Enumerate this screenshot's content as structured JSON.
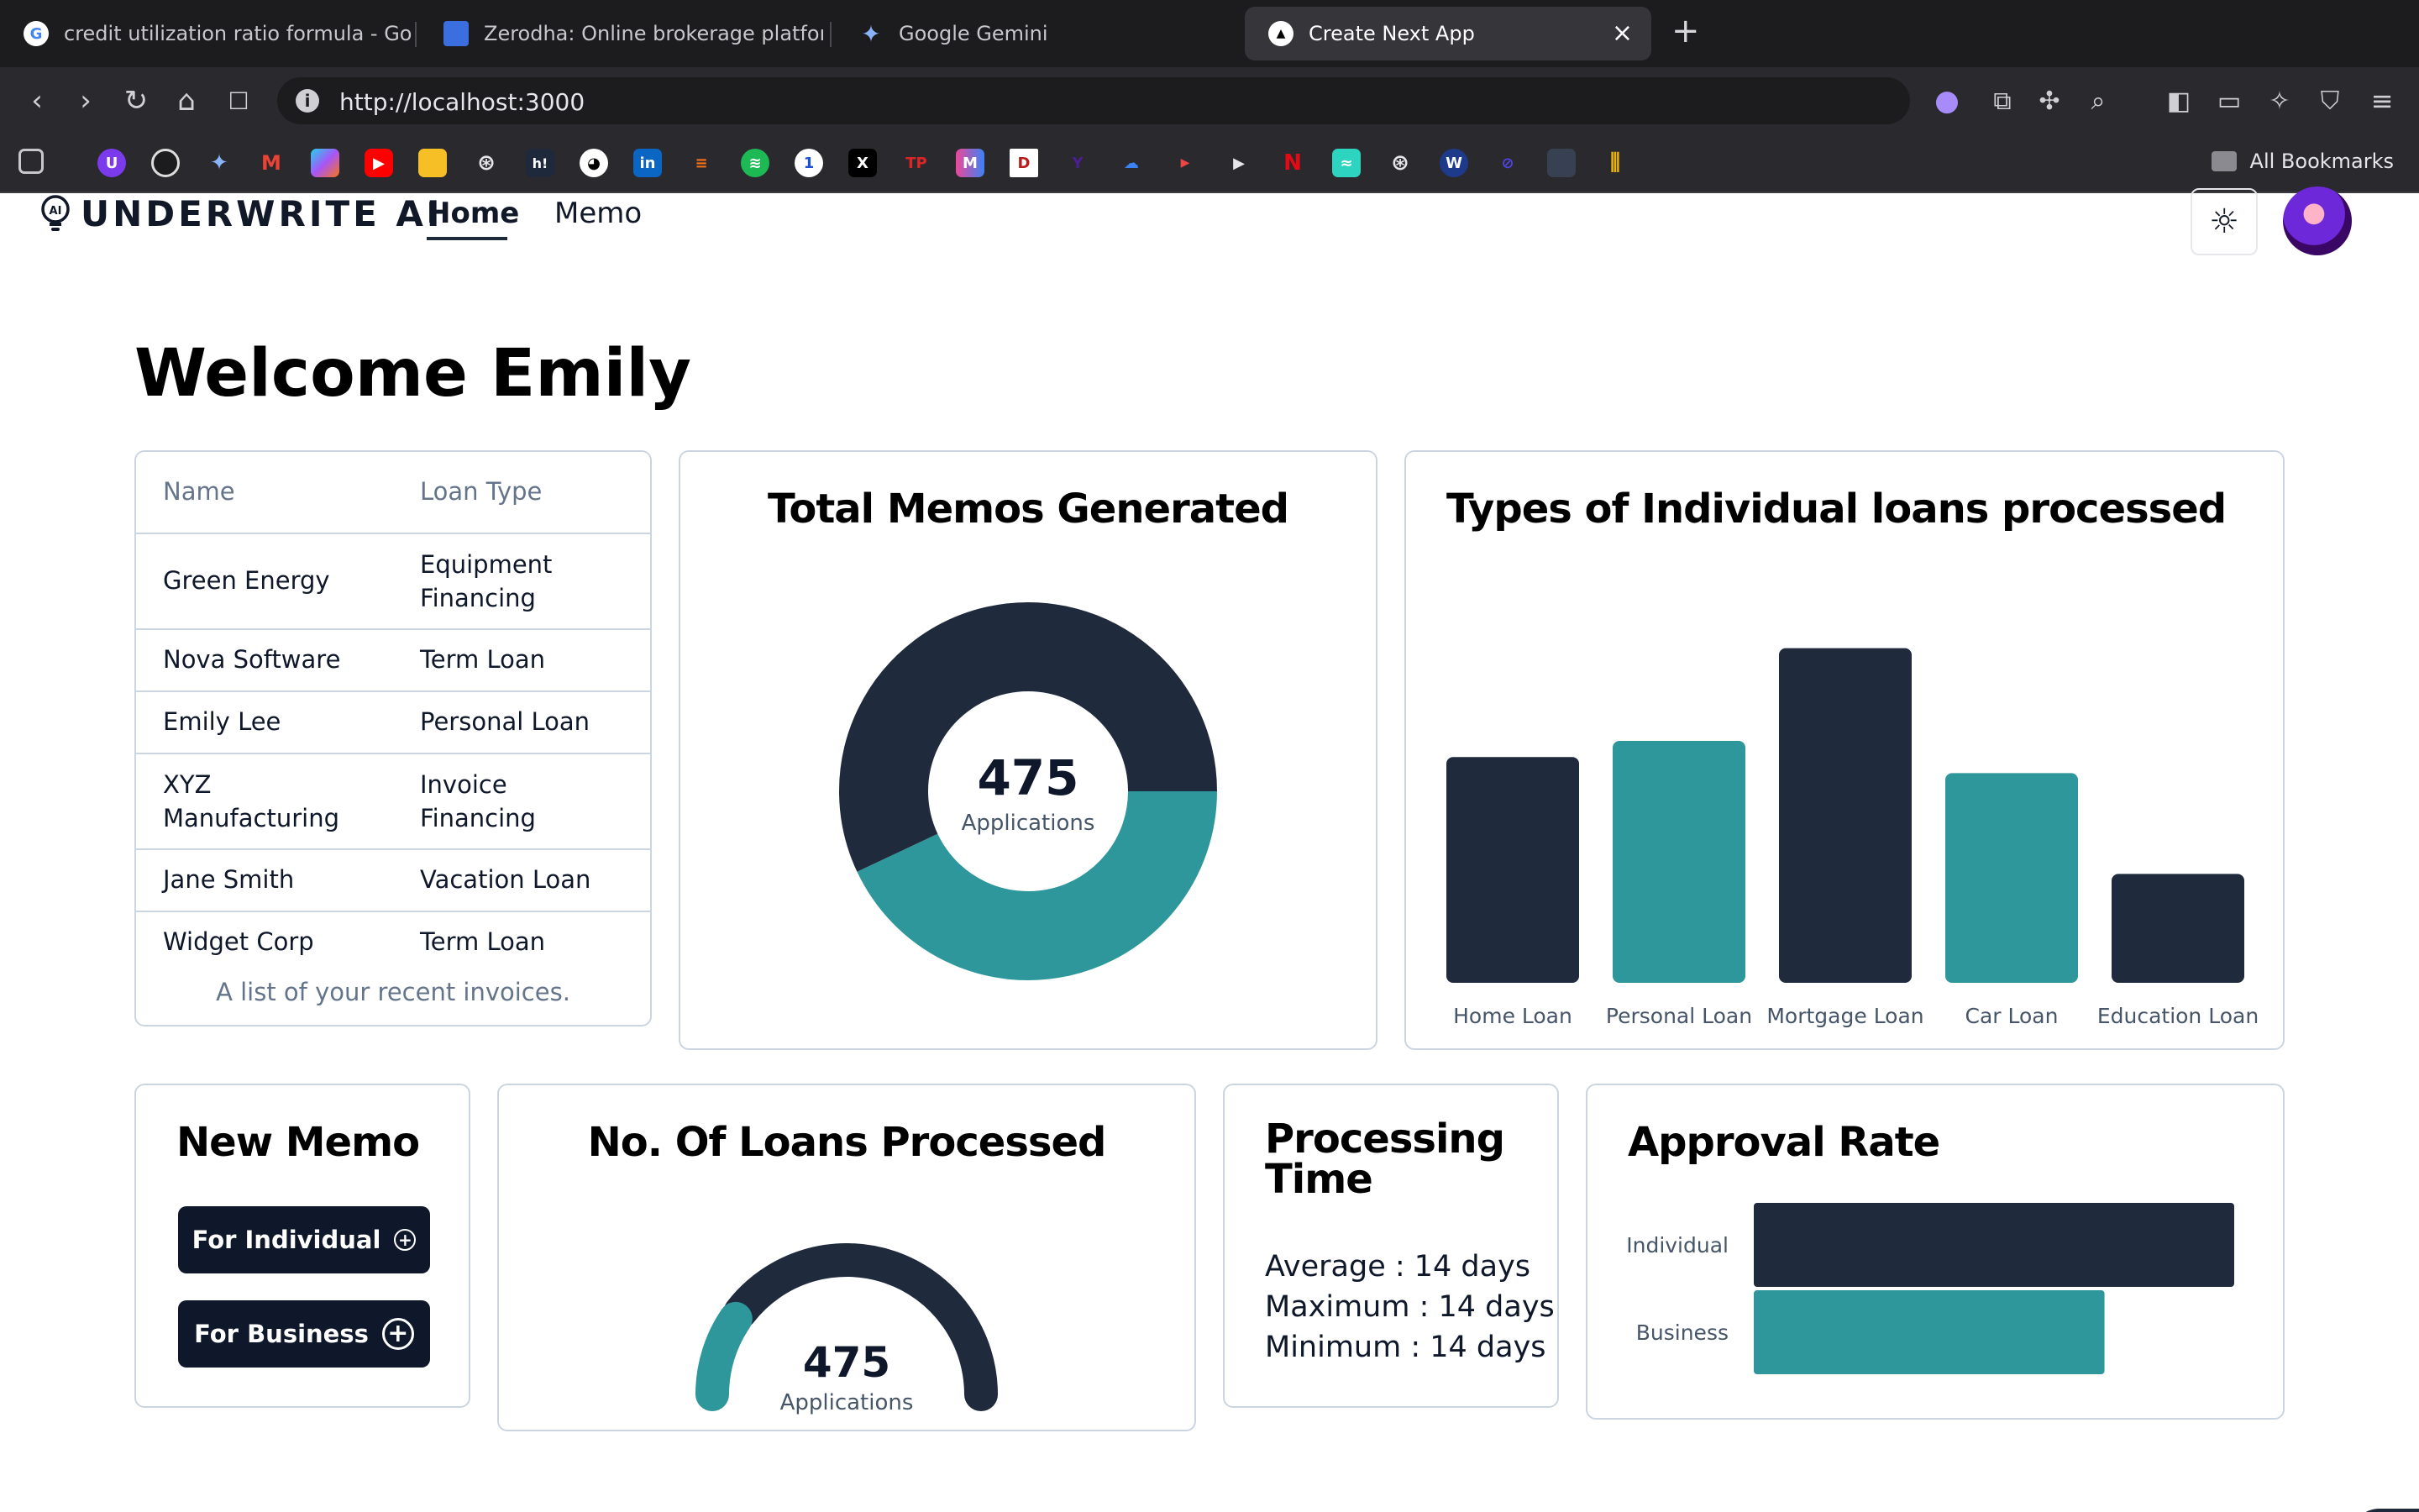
{
  "browser": {
    "tabs": [
      {
        "title": "credit utilization ratio formula - Go",
        "icon": "google-icon"
      },
      {
        "title": "Zerodha: Online brokerage platform",
        "icon": "zerodha-icon"
      },
      {
        "title": "Google Gemini",
        "icon": "gemini-icon"
      },
      {
        "title": "Create Next App",
        "icon": "nextjs-icon"
      }
    ],
    "url": "http://localhost:3000",
    "all_bookmarks": "All Bookmarks"
  },
  "app": {
    "logo_text": "UNDERWRITE AI",
    "nav": {
      "home": "Home",
      "memo": "Memo"
    },
    "welcome": "Welcome Emily"
  },
  "recent_table": {
    "headers": [
      "Name",
      "Loan Type"
    ],
    "rows": [
      {
        "name": "Green Energy",
        "type": "Equipment Financing"
      },
      {
        "name": "Nova Software",
        "type": "Term Loan"
      },
      {
        "name": "Emily Lee",
        "type": "Personal Loan"
      },
      {
        "name": "XYZ Manufacturing",
        "type": "Invoice Financing"
      },
      {
        "name": "Jane Smith",
        "type": "Vacation Loan"
      },
      {
        "name": "Widget Corp",
        "type": "Term Loan"
      }
    ],
    "caption": "A list of your recent invoices."
  },
  "memos": {
    "title": "Total Memos Generated",
    "count": "475",
    "label": "Applications"
  },
  "new_memo": {
    "title": "New Memo",
    "individual_button": "For Individual",
    "business_button": "For Business"
  },
  "loans_processed": {
    "title": "No. Of Loans Processed",
    "count": "475",
    "label": "Applications"
  },
  "processing_time": {
    "title": "Processing Time",
    "average": "Average : 14 days",
    "maximum": "Maximum : 14 days",
    "minimum": "Minimum : 14 days"
  },
  "approval": {
    "title": "Approval Rate",
    "rows": [
      {
        "label": "Individual",
        "value": 1.0
      },
      {
        "label": "Business",
        "value": 0.73
      }
    ]
  },
  "colors": {
    "navy": "#1f2a3d",
    "teal": "#2d979b"
  },
  "chart_data": [
    {
      "type": "pie",
      "title": "Total Memos Generated",
      "donut": true,
      "center_value": "475",
      "center_label": "Applications",
      "slices": [
        {
          "color": "#1f2a3d",
          "fraction": 0.57
        },
        {
          "color": "#2d979b",
          "fraction": 0.43
        }
      ]
    },
    {
      "type": "bar",
      "title": "Types of Individual loans processed",
      "categories": [
        "Home Loan",
        "Personal Loan",
        "Mortgage Loan",
        "Car Loan",
        "Education Loan"
      ],
      "values": [
        56,
        60,
        83,
        52,
        27
      ],
      "colors": [
        "#1f2a3d",
        "#2d979b",
        "#1f2a3d",
        "#2d979b",
        "#1f2a3d"
      ],
      "ylim": [
        0,
        100
      ]
    },
    {
      "type": "pie",
      "title": "No. Of Loans Processed",
      "gauge": true,
      "center_value": "475",
      "center_label": "Applications",
      "slices": [
        {
          "color": "#2d979b",
          "fraction": 0.2
        },
        {
          "color": "#1f2a3d",
          "fraction": 0.8
        }
      ]
    },
    {
      "type": "bar",
      "orientation": "horizontal",
      "title": "Approval Rate",
      "categories": [
        "Individual",
        "Business"
      ],
      "values": [
        1.0,
        0.73
      ],
      "colors": [
        "#1f2a3d",
        "#2d979b"
      ]
    }
  ]
}
